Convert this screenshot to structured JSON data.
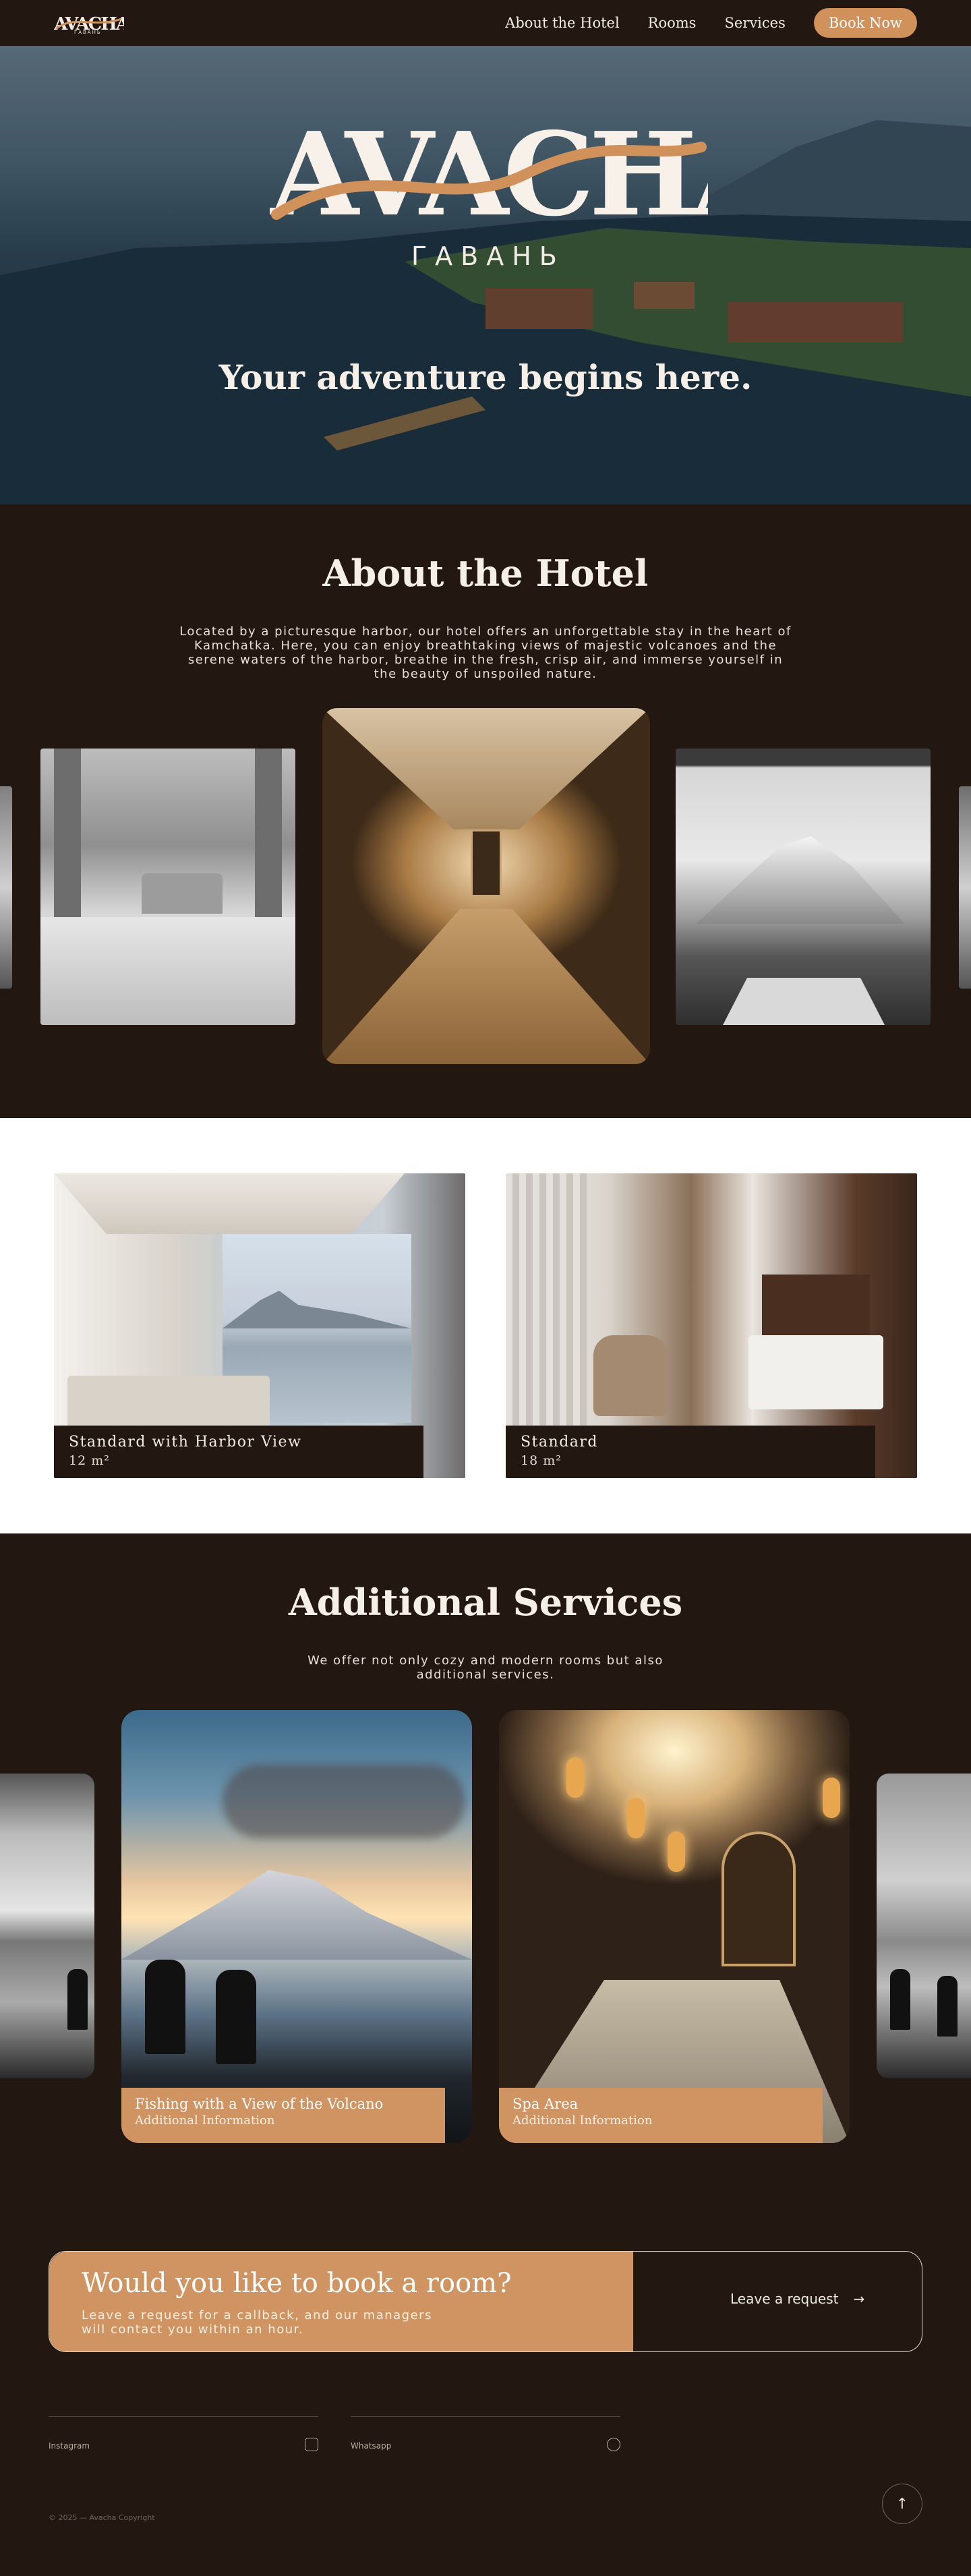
{
  "brand": {
    "name": "AVACHA",
    "subtitle": "ГАВАНЬ",
    "accent": "#d0915a",
    "background": "#231711"
  },
  "nav": {
    "items": [
      {
        "label": "About the Hotel"
      },
      {
        "label": "Rooms"
      },
      {
        "label": "Services"
      }
    ],
    "book_label": "Book Now"
  },
  "hero": {
    "tagline": "Your adventure begins here."
  },
  "about": {
    "title": "About the Hotel",
    "text": "Located by a picturesque harbor, our hotel offers an unforgettable stay in the heart of Kamchatka. Here, you can enjoy breathtaking views of majestic volcanoes and the serene waters of the harbor, breathe in the fresh, crisp air, and immerse yourself in the beauty of unspoiled nature."
  },
  "rooms": [
    {
      "name": "Standard with Harbor View",
      "area": "12 m²"
    },
    {
      "name": "Standard",
      "area": "18 m²"
    }
  ],
  "services": {
    "title": "Additional Services",
    "text": "We offer not only cozy and modern rooms but also additional services.",
    "items": [
      {
        "name": "Fishing with a View of the Volcano",
        "info": "Additional Information"
      },
      {
        "name": "Spa Area",
        "info": "Additional Information"
      }
    ]
  },
  "cta": {
    "title": "Would you like to book a room?",
    "subtitle": "Leave a request for a callback, and our managers will contact you within an hour.",
    "button_label": "Leave a request",
    "button_arrow": "→"
  },
  "footer": {
    "links": [
      {
        "label": "Instagram",
        "icon": "instagram-icon"
      },
      {
        "label": "Whatsapp",
        "icon": "whatsapp-icon"
      }
    ],
    "copyright": "© 2025 — Avacha Copyright",
    "to_top": "↑"
  }
}
